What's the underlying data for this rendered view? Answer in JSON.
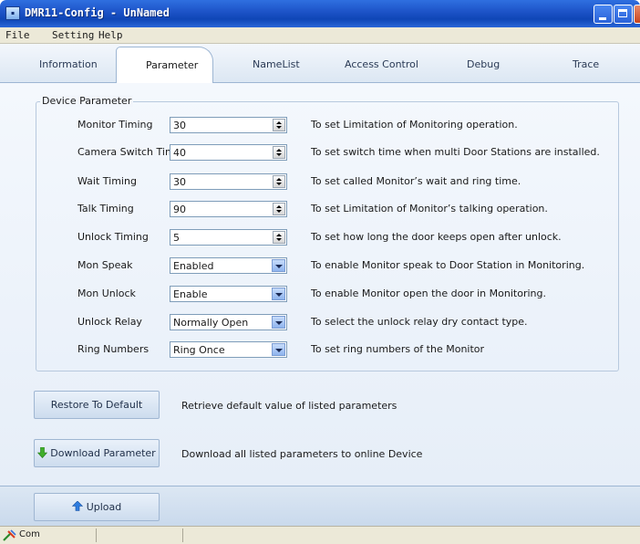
{
  "window": {
    "title": "DMR11-Config - UnNamed"
  },
  "menu": [
    "File",
    "Setting",
    "Help"
  ],
  "tabs": [
    "Information",
    "Parameter",
    "NameList",
    "Access Control",
    "Debug",
    "Trace"
  ],
  "active_tab": "Parameter",
  "group": {
    "title": "Device Parameter"
  },
  "params": [
    {
      "label": "Monitor Timing",
      "value": "30",
      "control": "spin",
      "desc": "To set Limitation of Monitoring operation."
    },
    {
      "label": "Camera Switch Timing",
      "value": "40",
      "control": "spin",
      "desc": "To set switch time when multi Door Stations are installed."
    },
    {
      "label": "Wait Timing",
      "value": "30",
      "control": "spin",
      "desc": "To set called Monitor’s wait and ring time."
    },
    {
      "label": "Talk Timing",
      "value": "90",
      "control": "spin",
      "desc": "To set Limitation of Monitor’s talking operation."
    },
    {
      "label": "Unlock Timing",
      "value": "5",
      "control": "spin",
      "desc": "To set how long the door keeps open after unlock."
    },
    {
      "label": "Mon Speak",
      "value": "Enabled",
      "control": "select",
      "desc": "To enable Monitor speak to Door Station in Monitoring."
    },
    {
      "label": "Mon Unlock",
      "value": "Enable",
      "control": "select",
      "desc": "To enable Monitor open the door in Monitoring."
    },
    {
      "label": "Unlock Relay",
      "value": "Normally Open",
      "control": "select",
      "desc": "To select the unlock relay dry contact type."
    },
    {
      "label": "Ring Numbers",
      "value": "Ring Once",
      "control": "select",
      "desc": "To set ring numbers of the Monitor"
    }
  ],
  "actions": {
    "restore_label": "Restore To Default",
    "restore_desc": "Retrieve default value of listed parameters",
    "download_label": "Download Parameter",
    "download_desc": "Download all listed parameters to online Device",
    "upload_label": "Upload"
  },
  "status": {
    "text": "Com"
  },
  "icons": {
    "download": "green-down-arrow-icon",
    "upload": "blue-up-arrow-icon",
    "status": "plug-icon"
  }
}
